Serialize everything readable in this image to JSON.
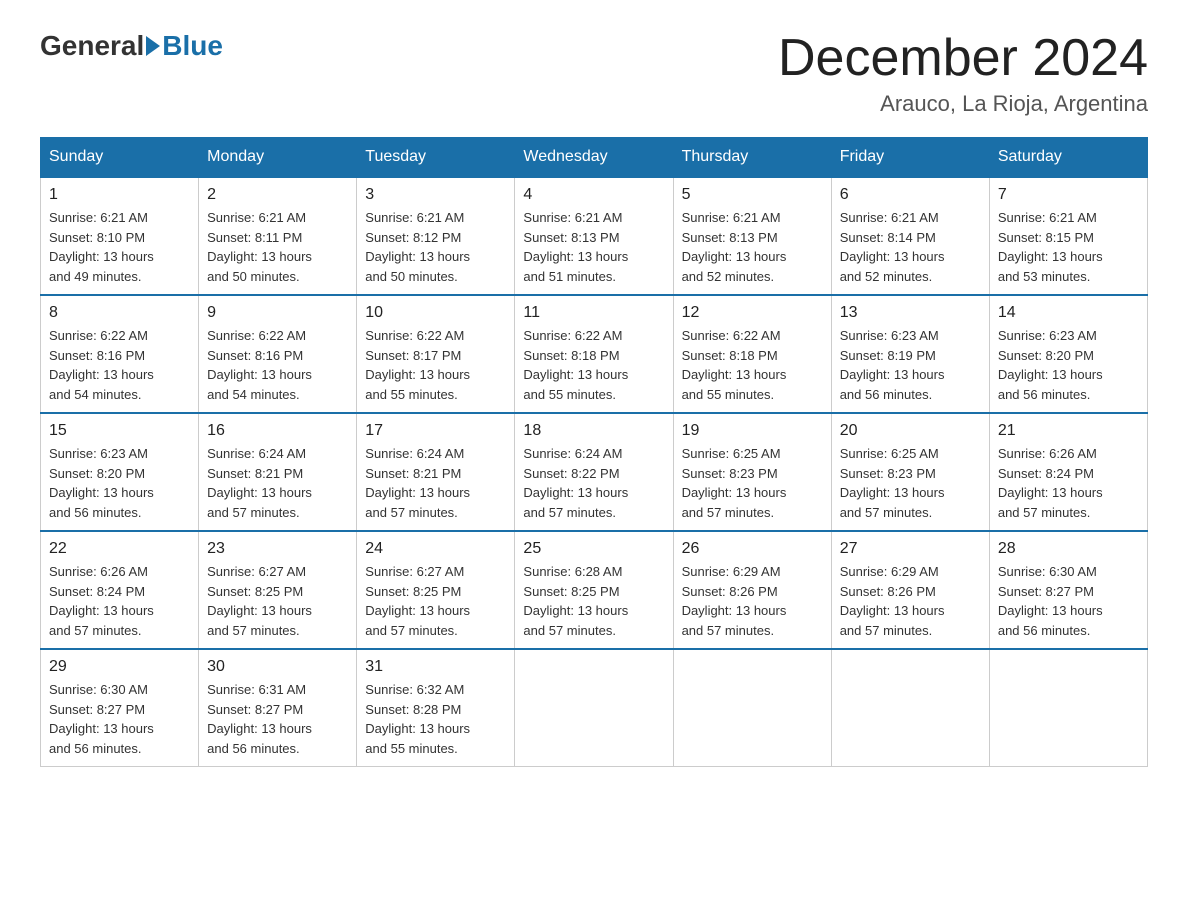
{
  "logo": {
    "general": "General",
    "blue": "Blue"
  },
  "title": "December 2024",
  "location": "Arauco, La Rioja, Argentina",
  "days_header": [
    "Sunday",
    "Monday",
    "Tuesday",
    "Wednesday",
    "Thursday",
    "Friday",
    "Saturday"
  ],
  "weeks": [
    [
      {
        "day": "1",
        "sunrise": "6:21 AM",
        "sunset": "8:10 PM",
        "daylight": "13 hours and 49 minutes."
      },
      {
        "day": "2",
        "sunrise": "6:21 AM",
        "sunset": "8:11 PM",
        "daylight": "13 hours and 50 minutes."
      },
      {
        "day": "3",
        "sunrise": "6:21 AM",
        "sunset": "8:12 PM",
        "daylight": "13 hours and 50 minutes."
      },
      {
        "day": "4",
        "sunrise": "6:21 AM",
        "sunset": "8:13 PM",
        "daylight": "13 hours and 51 minutes."
      },
      {
        "day": "5",
        "sunrise": "6:21 AM",
        "sunset": "8:13 PM",
        "daylight": "13 hours and 52 minutes."
      },
      {
        "day": "6",
        "sunrise": "6:21 AM",
        "sunset": "8:14 PM",
        "daylight": "13 hours and 52 minutes."
      },
      {
        "day": "7",
        "sunrise": "6:21 AM",
        "sunset": "8:15 PM",
        "daylight": "13 hours and 53 minutes."
      }
    ],
    [
      {
        "day": "8",
        "sunrise": "6:22 AM",
        "sunset": "8:16 PM",
        "daylight": "13 hours and 54 minutes."
      },
      {
        "day": "9",
        "sunrise": "6:22 AM",
        "sunset": "8:16 PM",
        "daylight": "13 hours and 54 minutes."
      },
      {
        "day": "10",
        "sunrise": "6:22 AM",
        "sunset": "8:17 PM",
        "daylight": "13 hours and 55 minutes."
      },
      {
        "day": "11",
        "sunrise": "6:22 AM",
        "sunset": "8:18 PM",
        "daylight": "13 hours and 55 minutes."
      },
      {
        "day": "12",
        "sunrise": "6:22 AM",
        "sunset": "8:18 PM",
        "daylight": "13 hours and 55 minutes."
      },
      {
        "day": "13",
        "sunrise": "6:23 AM",
        "sunset": "8:19 PM",
        "daylight": "13 hours and 56 minutes."
      },
      {
        "day": "14",
        "sunrise": "6:23 AM",
        "sunset": "8:20 PM",
        "daylight": "13 hours and 56 minutes."
      }
    ],
    [
      {
        "day": "15",
        "sunrise": "6:23 AM",
        "sunset": "8:20 PM",
        "daylight": "13 hours and 56 minutes."
      },
      {
        "day": "16",
        "sunrise": "6:24 AM",
        "sunset": "8:21 PM",
        "daylight": "13 hours and 57 minutes."
      },
      {
        "day": "17",
        "sunrise": "6:24 AM",
        "sunset": "8:21 PM",
        "daylight": "13 hours and 57 minutes."
      },
      {
        "day": "18",
        "sunrise": "6:24 AM",
        "sunset": "8:22 PM",
        "daylight": "13 hours and 57 minutes."
      },
      {
        "day": "19",
        "sunrise": "6:25 AM",
        "sunset": "8:23 PM",
        "daylight": "13 hours and 57 minutes."
      },
      {
        "day": "20",
        "sunrise": "6:25 AM",
        "sunset": "8:23 PM",
        "daylight": "13 hours and 57 minutes."
      },
      {
        "day": "21",
        "sunrise": "6:26 AM",
        "sunset": "8:24 PM",
        "daylight": "13 hours and 57 minutes."
      }
    ],
    [
      {
        "day": "22",
        "sunrise": "6:26 AM",
        "sunset": "8:24 PM",
        "daylight": "13 hours and 57 minutes."
      },
      {
        "day": "23",
        "sunrise": "6:27 AM",
        "sunset": "8:25 PM",
        "daylight": "13 hours and 57 minutes."
      },
      {
        "day": "24",
        "sunrise": "6:27 AM",
        "sunset": "8:25 PM",
        "daylight": "13 hours and 57 minutes."
      },
      {
        "day": "25",
        "sunrise": "6:28 AM",
        "sunset": "8:25 PM",
        "daylight": "13 hours and 57 minutes."
      },
      {
        "day": "26",
        "sunrise": "6:29 AM",
        "sunset": "8:26 PM",
        "daylight": "13 hours and 57 minutes."
      },
      {
        "day": "27",
        "sunrise": "6:29 AM",
        "sunset": "8:26 PM",
        "daylight": "13 hours and 57 minutes."
      },
      {
        "day": "28",
        "sunrise": "6:30 AM",
        "sunset": "8:27 PM",
        "daylight": "13 hours and 56 minutes."
      }
    ],
    [
      {
        "day": "29",
        "sunrise": "6:30 AM",
        "sunset": "8:27 PM",
        "daylight": "13 hours and 56 minutes."
      },
      {
        "day": "30",
        "sunrise": "6:31 AM",
        "sunset": "8:27 PM",
        "daylight": "13 hours and 56 minutes."
      },
      {
        "day": "31",
        "sunrise": "6:32 AM",
        "sunset": "8:28 PM",
        "daylight": "13 hours and 55 minutes."
      },
      null,
      null,
      null,
      null
    ]
  ],
  "labels": {
    "sunrise": "Sunrise:",
    "sunset": "Sunset:",
    "daylight": "Daylight:"
  }
}
